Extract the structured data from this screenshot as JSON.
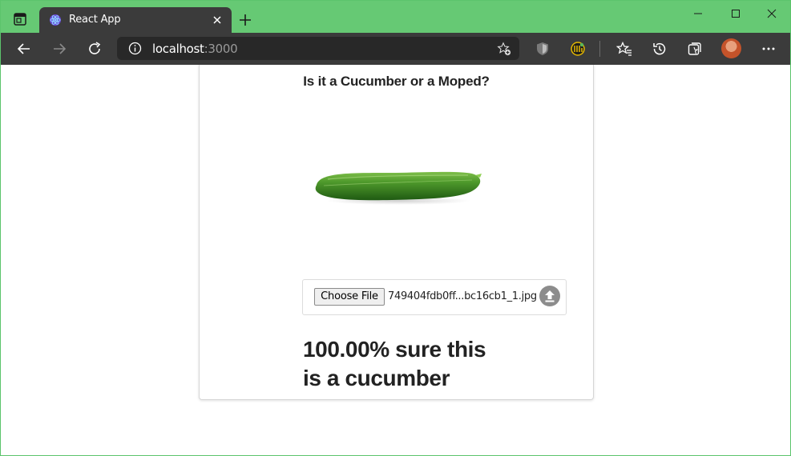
{
  "browser": {
    "tab_title": "React App",
    "address": {
      "host": "localhost",
      "port": ":3000"
    }
  },
  "page": {
    "title": "Is it a Cucumber or a Moped?",
    "file_input": {
      "button_label": "Choose File",
      "file_name": "749404fdb0ff...bc16cb1_1.jpg"
    },
    "result_line1": "100.00% sure this",
    "result_line2": "is a cucumber"
  },
  "icons": {
    "tab_actions": "tab-actions-icon",
    "favicon": "react-favicon-icon",
    "close": "close-icon",
    "new_tab": "plus-icon",
    "back": "back-arrow-icon",
    "forward": "forward-arrow-icon",
    "refresh": "refresh-icon",
    "info": "info-icon",
    "favorite_add": "star-plus-icon",
    "upload": "upload-icon"
  },
  "colors": {
    "titlebar": "#66c974",
    "toolbar": "#3b3b3b",
    "address_bg": "#282828",
    "upload_icon": "#8c8c8c"
  }
}
